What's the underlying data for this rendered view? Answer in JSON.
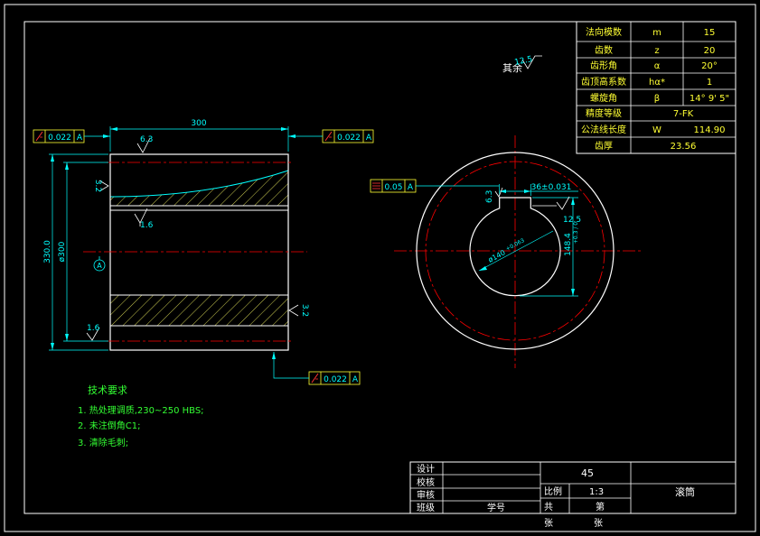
{
  "colors": {
    "background": "#000000",
    "outline": "#ffffff",
    "frame": "#00ffff",
    "dimension": "#00ffff",
    "centerline": "#ff0000",
    "hatch": "#ffff66",
    "text_title": "#ffffff",
    "text_table": "#ffff33",
    "text_notes": "#33ff33"
  },
  "param_table": [
    {
      "name": "法向模数",
      "symbol": "m",
      "value": "15"
    },
    {
      "name": "齿数",
      "symbol": "z",
      "value": "20"
    },
    {
      "name": "齿形角",
      "symbol": "α",
      "value": "20°"
    },
    {
      "name": "齿顶高系数",
      "symbol": "hα*",
      "value": "1"
    },
    {
      "name": "螺旋角",
      "symbol": "β",
      "value": "14° 9' 5\""
    },
    {
      "name": "精度等级",
      "symbol": "",
      "value": "7-FK"
    },
    {
      "name": "公法线长度",
      "symbol": "W",
      "value": "114.90"
    },
    {
      "name": "齿厚",
      "symbol": "",
      "value": "23.56"
    }
  ],
  "roughness_other": {
    "prefix": "其余",
    "value": "12.5"
  },
  "front_view": {
    "length_dim": "300",
    "outer_dim": "330.0",
    "inner_dim": "ø300",
    "roughness_top": "6.3",
    "roughness_left_top": "3.2",
    "roughness_inner": "1.6",
    "roughness_left_bottom": "1.6",
    "roughness_right_bottom": "3.2",
    "datum_label": "A",
    "fcf_left": {
      "tolerance": "0.022",
      "datum": "A"
    },
    "fcf_right": {
      "tolerance": "0.022",
      "datum": "A"
    },
    "fcf_bottom": {
      "tolerance": "0.022",
      "datum": "A"
    }
  },
  "side_view": {
    "fcf_parallel": {
      "tolerance": "0.05",
      "datum": "A"
    },
    "keyway_width": "36±0.031",
    "keyway_depth": "148.4",
    "keyway_depth_tol": "+0.3 / 0",
    "bore_dia": "ø140",
    "bore_tol": "+0.063",
    "roughness_keyway": "6.3",
    "roughness_key_side": "12.5"
  },
  "notes": {
    "title": "技术要求",
    "items": [
      "1.  热处理调质,230~250 HBS;",
      "2.  未注倒角C1;",
      "3.  清除毛刺;"
    ]
  },
  "title_block": {
    "row_labels": [
      "设计",
      "校核",
      "审核",
      "班级"
    ],
    "student_no": "学号",
    "material": "45",
    "scale_label": "比例",
    "scale_value": "1:3",
    "part_name": "滚筒",
    "total_label": "共",
    "sheet_label": "第",
    "zhang1": "张",
    "zhang2": "张"
  }
}
